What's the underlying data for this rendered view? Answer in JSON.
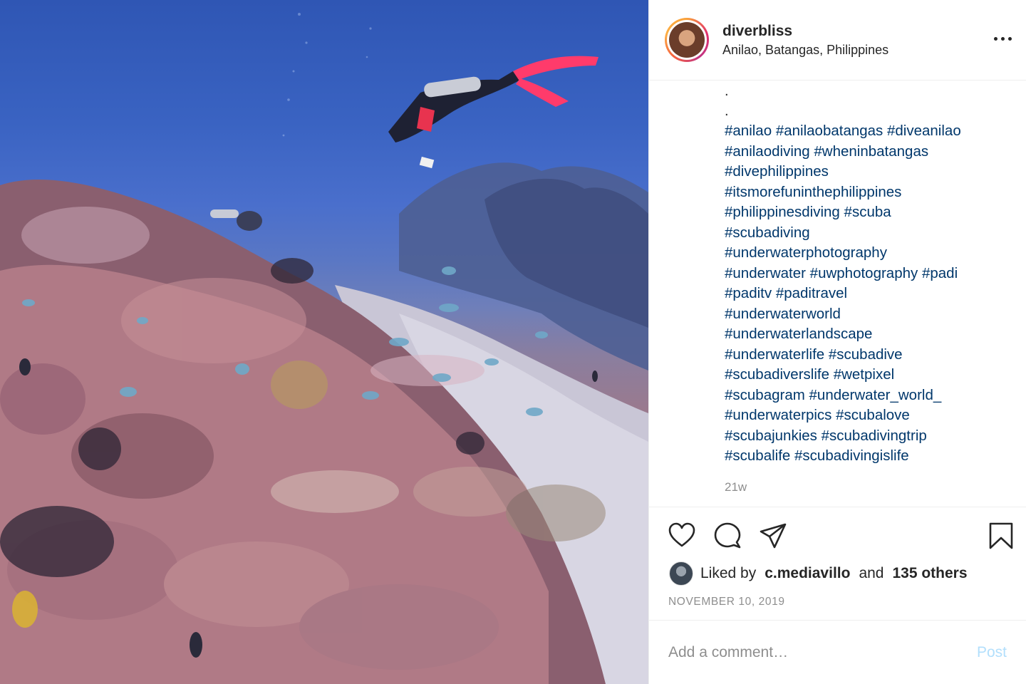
{
  "post": {
    "photo_description": "",
    "username": "diverbliss",
    "location": "Anilao, Batangas, Philippines",
    "caption_dots": [
      ".",
      "."
    ],
    "hashtag_lines": [
      [
        "#anilao",
        "#anilaobatangas",
        "#diveanilao"
      ],
      [
        "#anilaodiving",
        "#wheninbatangas"
      ],
      [
        "#divephilippines"
      ],
      [
        "#itsmorefuninthephilippines"
      ],
      [
        "#philippinesdiving",
        "#scuba"
      ],
      [
        "#scubadiving"
      ],
      [
        "#underwaterphotography"
      ],
      [
        "#underwater",
        "#uwphotography",
        "#padi"
      ],
      [
        "#paditv",
        "#paditravel"
      ],
      [
        "#underwaterworld"
      ],
      [
        "#underwaterlandscape"
      ],
      [
        "#underwaterlife",
        "#scubadive"
      ],
      [
        "#scubadiverslife",
        "#wetpixel"
      ],
      [
        "#scubagram",
        "#underwater_world_"
      ],
      [
        "#underwaterpics",
        "#scubalove"
      ],
      [
        "#scubajunkies",
        "#scubadivingtrip"
      ],
      [
        "#scubalife",
        "#scubadivingislife"
      ]
    ],
    "age": "21w",
    "likes": {
      "prefix": "Liked by",
      "user": "c.mediavillo",
      "conjunction": "and",
      "others": "135 others"
    },
    "date": "NOVEMBER 10, 2019"
  },
  "actions": {
    "icons": [
      "heart-icon",
      "comment-icon",
      "share-icon",
      "bookmark-icon",
      "more-options-icon"
    ]
  },
  "comment_box": {
    "placeholder": "Add a comment…",
    "post_label": "Post",
    "post_color": "#b2dffc"
  },
  "colors": {
    "hashtag": "#00376b",
    "muted": "#8e8e8e",
    "text": "#262626"
  }
}
